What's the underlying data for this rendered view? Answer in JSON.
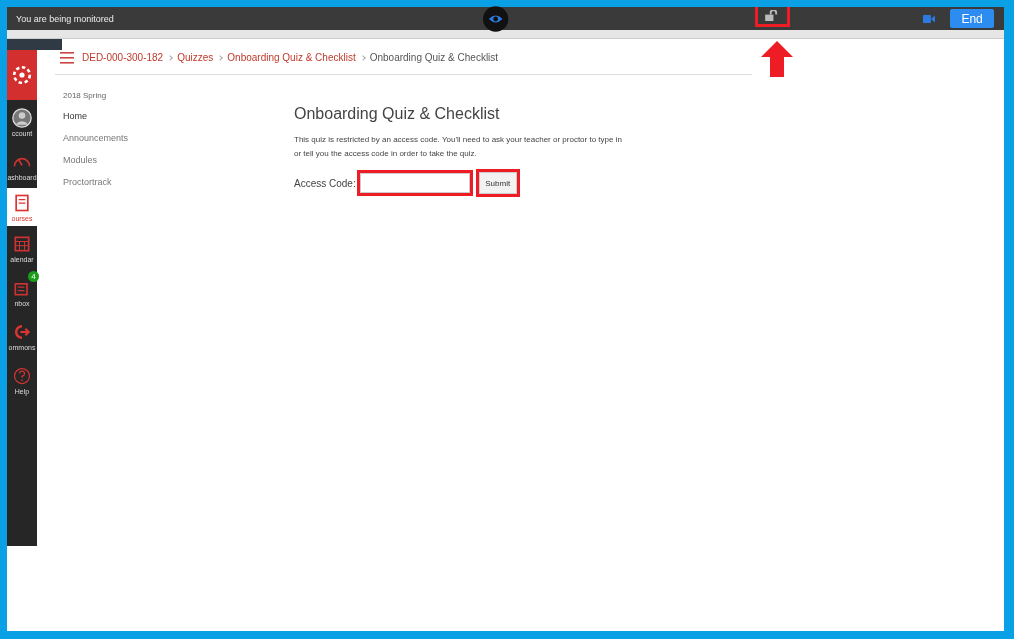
{
  "monitor_bar": {
    "message": "You are being monitored",
    "lock": {
      "highlighted": true,
      "pointer_arrow": true
    },
    "end_button": "End"
  },
  "global_nav": {
    "items": [
      {
        "kind": "logo",
        "selected": false
      },
      {
        "kind": "account",
        "label": "ccount",
        "selected": false
      },
      {
        "kind": "dashboard",
        "label": "ashboard",
        "selected": false
      },
      {
        "kind": "courses",
        "label": "ourses",
        "selected": true
      },
      {
        "kind": "calendar",
        "label": "alendar",
        "selected": false
      },
      {
        "kind": "inbox",
        "label": "nbox",
        "badge": "4",
        "selected": false
      },
      {
        "kind": "commons",
        "label": "ommons",
        "selected": false
      },
      {
        "kind": "help",
        "label": "Help",
        "selected": false
      }
    ]
  },
  "breadcrumbs": [
    "DED-000-300-182",
    "Quizzes",
    "Onboarding Quiz & Checklist",
    "Onboarding Quiz & Checklist"
  ],
  "course_nav": {
    "term": "2018 Spring",
    "items": [
      {
        "label": "Home",
        "selected": true
      },
      {
        "label": "Announcements",
        "selected": false
      },
      {
        "label": "Modules",
        "selected": false
      },
      {
        "label": "Proctortrack",
        "selected": false
      }
    ]
  },
  "quiz": {
    "title": "Onboarding Quiz & Checklist",
    "description": "This quiz is restricted by an access code. You'll need to ask your teacher or proctor to type in or tell you the access code in order to take the quiz.",
    "access_code_label": "Access Code:",
    "access_code_highlighted": true,
    "submit_button": "Submit",
    "submit_highlighted": true
  }
}
